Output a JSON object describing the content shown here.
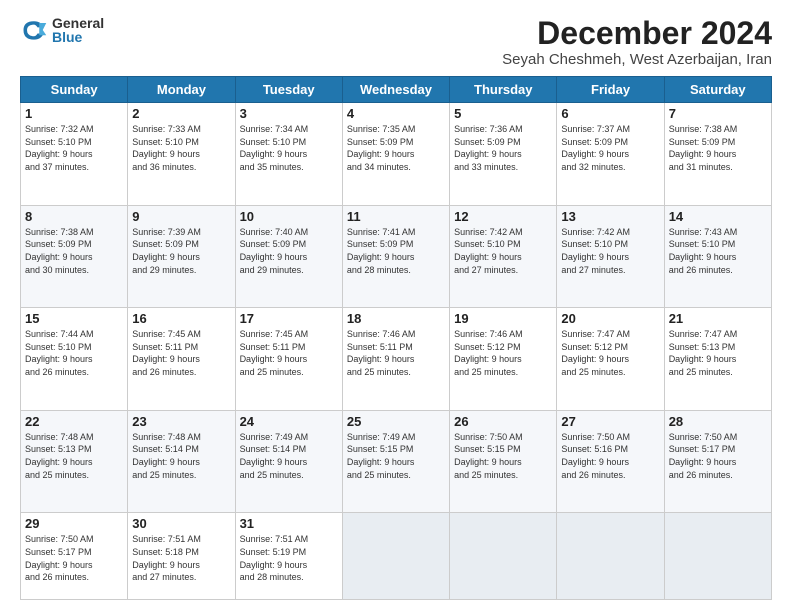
{
  "logo": {
    "general": "General",
    "blue": "Blue"
  },
  "title": "December 2024",
  "location": "Seyah Cheshmeh, West Azerbaijan, Iran",
  "days_header": [
    "Sunday",
    "Monday",
    "Tuesday",
    "Wednesday",
    "Thursday",
    "Friday",
    "Saturday"
  ],
  "weeks": [
    [
      {
        "day": "1",
        "info": "Sunrise: 7:32 AM\nSunset: 5:10 PM\nDaylight: 9 hours\nand 37 minutes."
      },
      {
        "day": "2",
        "info": "Sunrise: 7:33 AM\nSunset: 5:10 PM\nDaylight: 9 hours\nand 36 minutes."
      },
      {
        "day": "3",
        "info": "Sunrise: 7:34 AM\nSunset: 5:10 PM\nDaylight: 9 hours\nand 35 minutes."
      },
      {
        "day": "4",
        "info": "Sunrise: 7:35 AM\nSunset: 5:09 PM\nDaylight: 9 hours\nand 34 minutes."
      },
      {
        "day": "5",
        "info": "Sunrise: 7:36 AM\nSunset: 5:09 PM\nDaylight: 9 hours\nand 33 minutes."
      },
      {
        "day": "6",
        "info": "Sunrise: 7:37 AM\nSunset: 5:09 PM\nDaylight: 9 hours\nand 32 minutes."
      },
      {
        "day": "7",
        "info": "Sunrise: 7:38 AM\nSunset: 5:09 PM\nDaylight: 9 hours\nand 31 minutes."
      }
    ],
    [
      {
        "day": "8",
        "info": "Sunrise: 7:38 AM\nSunset: 5:09 PM\nDaylight: 9 hours\nand 30 minutes."
      },
      {
        "day": "9",
        "info": "Sunrise: 7:39 AM\nSunset: 5:09 PM\nDaylight: 9 hours\nand 29 minutes."
      },
      {
        "day": "10",
        "info": "Sunrise: 7:40 AM\nSunset: 5:09 PM\nDaylight: 9 hours\nand 29 minutes."
      },
      {
        "day": "11",
        "info": "Sunrise: 7:41 AM\nSunset: 5:09 PM\nDaylight: 9 hours\nand 28 minutes."
      },
      {
        "day": "12",
        "info": "Sunrise: 7:42 AM\nSunset: 5:10 PM\nDaylight: 9 hours\nand 27 minutes."
      },
      {
        "day": "13",
        "info": "Sunrise: 7:42 AM\nSunset: 5:10 PM\nDaylight: 9 hours\nand 27 minutes."
      },
      {
        "day": "14",
        "info": "Sunrise: 7:43 AM\nSunset: 5:10 PM\nDaylight: 9 hours\nand 26 minutes."
      }
    ],
    [
      {
        "day": "15",
        "info": "Sunrise: 7:44 AM\nSunset: 5:10 PM\nDaylight: 9 hours\nand 26 minutes."
      },
      {
        "day": "16",
        "info": "Sunrise: 7:45 AM\nSunset: 5:11 PM\nDaylight: 9 hours\nand 26 minutes."
      },
      {
        "day": "17",
        "info": "Sunrise: 7:45 AM\nSunset: 5:11 PM\nDaylight: 9 hours\nand 25 minutes."
      },
      {
        "day": "18",
        "info": "Sunrise: 7:46 AM\nSunset: 5:11 PM\nDaylight: 9 hours\nand 25 minutes."
      },
      {
        "day": "19",
        "info": "Sunrise: 7:46 AM\nSunset: 5:12 PM\nDaylight: 9 hours\nand 25 minutes."
      },
      {
        "day": "20",
        "info": "Sunrise: 7:47 AM\nSunset: 5:12 PM\nDaylight: 9 hours\nand 25 minutes."
      },
      {
        "day": "21",
        "info": "Sunrise: 7:47 AM\nSunset: 5:13 PM\nDaylight: 9 hours\nand 25 minutes."
      }
    ],
    [
      {
        "day": "22",
        "info": "Sunrise: 7:48 AM\nSunset: 5:13 PM\nDaylight: 9 hours\nand 25 minutes."
      },
      {
        "day": "23",
        "info": "Sunrise: 7:48 AM\nSunset: 5:14 PM\nDaylight: 9 hours\nand 25 minutes."
      },
      {
        "day": "24",
        "info": "Sunrise: 7:49 AM\nSunset: 5:14 PM\nDaylight: 9 hours\nand 25 minutes."
      },
      {
        "day": "25",
        "info": "Sunrise: 7:49 AM\nSunset: 5:15 PM\nDaylight: 9 hours\nand 25 minutes."
      },
      {
        "day": "26",
        "info": "Sunrise: 7:50 AM\nSunset: 5:15 PM\nDaylight: 9 hours\nand 25 minutes."
      },
      {
        "day": "27",
        "info": "Sunrise: 7:50 AM\nSunset: 5:16 PM\nDaylight: 9 hours\nand 26 minutes."
      },
      {
        "day": "28",
        "info": "Sunrise: 7:50 AM\nSunset: 5:17 PM\nDaylight: 9 hours\nand 26 minutes."
      }
    ],
    [
      {
        "day": "29",
        "info": "Sunrise: 7:50 AM\nSunset: 5:17 PM\nDaylight: 9 hours\nand 26 minutes."
      },
      {
        "day": "30",
        "info": "Sunrise: 7:51 AM\nSunset: 5:18 PM\nDaylight: 9 hours\nand 27 minutes."
      },
      {
        "day": "31",
        "info": "Sunrise: 7:51 AM\nSunset: 5:19 PM\nDaylight: 9 hours\nand 28 minutes."
      },
      {
        "day": "",
        "info": ""
      },
      {
        "day": "",
        "info": ""
      },
      {
        "day": "",
        "info": ""
      },
      {
        "day": "",
        "info": ""
      }
    ]
  ]
}
